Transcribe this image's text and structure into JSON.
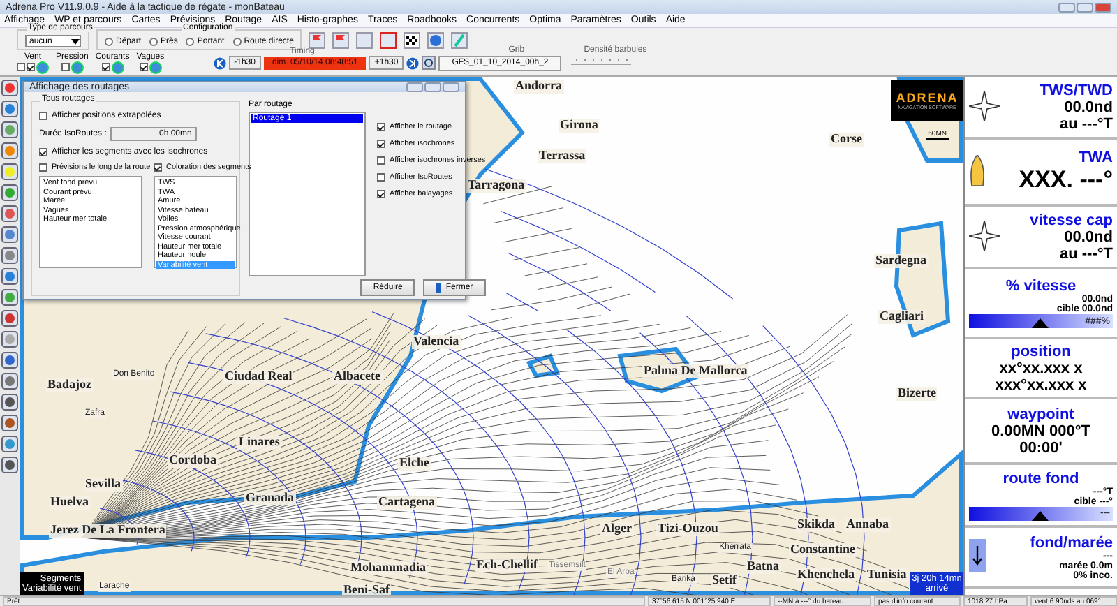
{
  "window": {
    "title": "Adrena Pro V11.9.0.9 - Aide à la tactique de régate - monBateau"
  },
  "menu": [
    "Affichage",
    "WP et parcours",
    "Cartes",
    "Prévisions",
    "Routage",
    "AIS",
    "Histo-graphes",
    "Traces",
    "Roadbooks",
    "Concurrents",
    "Optima",
    "Paramètres",
    "Outils",
    "Aide"
  ],
  "toolbar": {
    "parcours": {
      "label": "Type de parcours",
      "value": "aucun"
    },
    "configuration": {
      "label": "Configuration",
      "options": [
        {
          "label": "Départ",
          "selected": false
        },
        {
          "label": "Près",
          "selected": false
        },
        {
          "label": "Portant",
          "selected": false
        },
        {
          "label": "Route directe",
          "selected": false
        }
      ]
    },
    "layers": [
      {
        "label": "Vent",
        "checks": [
          false,
          true
        ]
      },
      {
        "label": "Pression",
        "checks": [
          false
        ]
      },
      {
        "label": "Courants",
        "checks": [
          true
        ]
      },
      {
        "label": "Vagues",
        "checks": [
          true
        ]
      }
    ],
    "timing": {
      "label": "Timing",
      "back": "-1h30",
      "date": "dim. 05/10/14 08:48:51",
      "forward": "+1h30"
    },
    "grib": {
      "label": "Grib",
      "file": "GFS_01_10_2014_00h_2"
    },
    "density": {
      "label": "Densité barbules"
    }
  },
  "map": {
    "labels": [
      {
        "text": "Andorra",
        "kind": "big"
      },
      {
        "text": "Girona",
        "kind": "big"
      },
      {
        "text": "Corse",
        "kind": "big"
      },
      {
        "text": "Terrassa",
        "kind": "big"
      },
      {
        "text": "Tarragona",
        "kind": "big"
      },
      {
        "text": "Sardegna",
        "kind": "big"
      },
      {
        "text": "Cagliari",
        "kind": "big"
      },
      {
        "text": "Valencia",
        "kind": "big"
      },
      {
        "text": "Badajoz",
        "kind": "big"
      },
      {
        "text": "Don Benito",
        "kind": "small"
      },
      {
        "text": "Ciudad Real",
        "kind": "big"
      },
      {
        "text": "Albacete",
        "kind": "big"
      },
      {
        "text": "Palma De Mallorca",
        "kind": "big"
      },
      {
        "text": "Bizerte",
        "kind": "big"
      },
      {
        "text": "Zafra",
        "kind": "small"
      },
      {
        "text": "Linares",
        "kind": "big"
      },
      {
        "text": "Cordoba",
        "kind": "big"
      },
      {
        "text": "Elche",
        "kind": "big"
      },
      {
        "text": "Sevilla",
        "kind": "big"
      },
      {
        "text": "Huelva",
        "kind": "big"
      },
      {
        "text": "Granada",
        "kind": "big"
      },
      {
        "text": "Cartagena",
        "kind": "big"
      },
      {
        "text": "Jerez De La Frontera",
        "kind": "big"
      },
      {
        "text": "Alger",
        "kind": "big"
      },
      {
        "text": "Tizi-Ouzou",
        "kind": "big"
      },
      {
        "text": "Skikda",
        "kind": "big"
      },
      {
        "text": "Annaba",
        "kind": "big"
      },
      {
        "text": "Kherrata",
        "kind": "small"
      },
      {
        "text": "Constantine",
        "kind": "big"
      },
      {
        "text": "Mohammadia",
        "kind": "big"
      },
      {
        "text": "Ech-Chellif",
        "kind": "big"
      },
      {
        "text": "Tissemsilt",
        "kind": "light"
      },
      {
        "text": "El Arba",
        "kind": "light"
      },
      {
        "text": "Barika",
        "kind": "small"
      },
      {
        "text": "Setif",
        "kind": "big"
      },
      {
        "text": "Batna",
        "kind": "big"
      },
      {
        "text": "Khenchela",
        "kind": "big"
      },
      {
        "text": "Tunisia",
        "kind": "big"
      },
      {
        "text": "Larache",
        "kind": "small"
      },
      {
        "text": "Beni-Saf",
        "kind": "big"
      }
    ],
    "logo": {
      "name": "ADRENA",
      "tagline": "NAVIGATION SOFTWARE"
    },
    "scale": "60MN",
    "legend": [
      "Segments",
      "Variabilité vent"
    ],
    "arrival": [
      "3j 20h 14mn",
      "arrivé"
    ]
  },
  "dialog": {
    "title": "Affichage des routages",
    "all": {
      "label": "Tous routages",
      "extrapolated": {
        "label": "Afficher positions extrapolées",
        "checked": false
      },
      "duration_label": "Durée IsoRoutes :",
      "duration": "0h 00mn",
      "segments": {
        "label": "Afficher les segments avec les isochrones",
        "checked": true
      },
      "forecast": {
        "label": "Prévisions le long de la route",
        "checked": false
      },
      "coloring": {
        "label": "Coloration des segments",
        "checked": true
      },
      "forecast_items": [
        "Vent fond prévu",
        "Courant prévu",
        "Marée",
        "Vagues",
        "Hauteur mer totale"
      ],
      "coloring_items": [
        {
          "label": "TWS",
          "selected": false
        },
        {
          "label": "TWA",
          "selected": false
        },
        {
          "label": "Amure",
          "selected": false
        },
        {
          "label": "Vitesse bateau",
          "selected": false
        },
        {
          "label": "Voiles",
          "selected": false
        },
        {
          "label": "Pression atmosphérique",
          "selected": false
        },
        {
          "label": "Vitesse courant",
          "selected": false
        },
        {
          "label": "Hauteur mer totale",
          "selected": false
        },
        {
          "label": "Hauteur houle",
          "selected": false
        },
        {
          "label": "Variabilité vent",
          "selected": true
        }
      ]
    },
    "per": {
      "label": "Par routage",
      "routings": [
        {
          "label": "Routage 1",
          "selected": true
        }
      ],
      "options": [
        {
          "label": "Afficher le routage",
          "checked": true
        },
        {
          "label": "Afficher isochrones",
          "checked": true
        },
        {
          "label": "Afficher isochrones inverses",
          "checked": false
        },
        {
          "label": "Afficher IsoRoutes",
          "checked": false
        },
        {
          "label": "Afficher balayages",
          "checked": true
        }
      ]
    },
    "buttons": [
      "Réduire",
      "Fermer"
    ]
  },
  "instruments": [
    {
      "kind": "wind",
      "title": "TWS/TWD",
      "lines": [
        "00.0nd",
        "au ---°T"
      ]
    },
    {
      "kind": "boat",
      "title": "TWA",
      "lines": [
        "XXX. ---°"
      ]
    },
    {
      "kind": "wind",
      "title": "vitesse cap",
      "lines": [
        "00.0nd",
        "au ---°T"
      ]
    },
    {
      "kind": "bar",
      "title": "% vitesse",
      "lines": [
        "00.0nd",
        "cible 00.0nd"
      ],
      "bar_text": "###%"
    },
    {
      "kind": "text",
      "title": "position",
      "lines": [
        "xx°xx.xxx x",
        "xxx°xx.xxx x"
      ]
    },
    {
      "kind": "text",
      "title": "waypoint",
      "lines": [
        "0.00MN 000°T",
        "00:00'"
      ]
    },
    {
      "kind": "bar",
      "title": "route fond",
      "lines": [
        "---°T",
        "cible ---°"
      ],
      "bar_text": "---"
    },
    {
      "kind": "arrow",
      "title": "fond/marée",
      "lines": [
        "---",
        "marée 0.0m",
        "0% inco."
      ]
    }
  ],
  "status_bar": [
    "Prêt",
    "37°56.615 N 001°25.940 E",
    "--MN à ---° du bateau",
    "pas d'info courant",
    "1018.27 hPa",
    "vent 6.90nds au 069°"
  ]
}
